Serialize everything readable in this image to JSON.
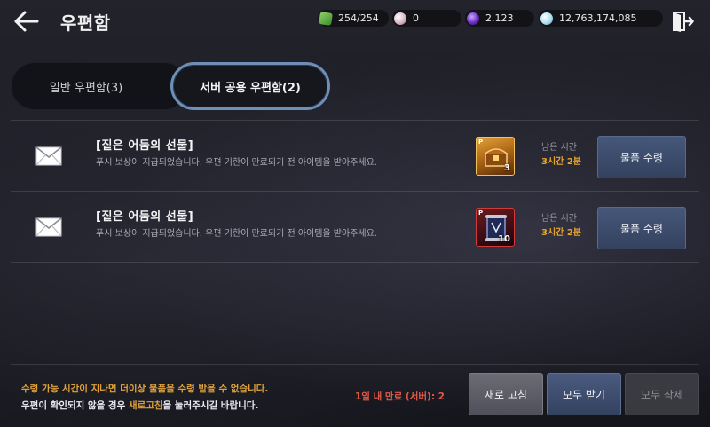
{
  "header": {
    "title": "우편함",
    "resources": {
      "energy": "254/254",
      "pearl": "0",
      "orb": "2,123",
      "silver": "12,763,174,085"
    }
  },
  "tabs": [
    {
      "label": "일반 우편함(3)",
      "active": false
    },
    {
      "label": "서버 공용 우편함(2)",
      "active": true
    }
  ],
  "mails": [
    {
      "title": "[짙은 어둠의 선물]",
      "desc": "푸시 보상이 지급되었습니다. 우편 기한이 만료되기 전 아이템을 받아주세요.",
      "item_icon": "treasure-chest-icon",
      "item_count": "3",
      "remaining_label": "남은 시간",
      "remaining_value": "3시간 2분",
      "claim_label": "물품 수령"
    },
    {
      "title": "[짙은 어둠의 선물]",
      "desc": "푸시 보상이 지급되었습니다. 우편 기한이 만료되기 전 아이템을 받아주세요.",
      "item_icon": "scroll-icon",
      "item_count": "10",
      "remaining_label": "남은 시간",
      "remaining_value": "3시간 2분",
      "claim_label": "물품 수령"
    }
  ],
  "footer": {
    "notice_line1": "수령 가능 시간이 지나면 더이상 물품을 수령 받을 수 없습니다.",
    "notice_line2_pre": "우편이 확인되지 않을 경우 ",
    "notice_line2_hl": "새로고침",
    "notice_line2_post": "을 눌러주시길 바랍니다.",
    "expire_text": "1일 내 만료 (서버): 2",
    "refresh_label": "새로 고침",
    "receive_all_label": "모두 받기",
    "delete_all_label": "모두 삭제"
  },
  "colors": {
    "accent_orange": "#e0a33c",
    "expire_red": "#e05a4a",
    "tab_active_border": "#6e8fb6",
    "button_blue": "#34425f"
  }
}
